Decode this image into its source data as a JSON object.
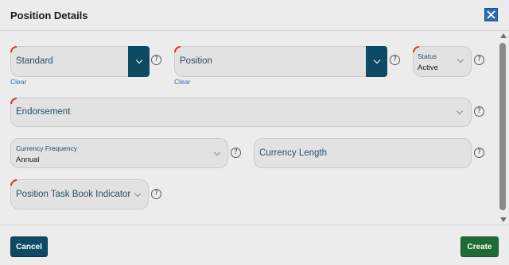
{
  "dialog": {
    "title": "Position Details",
    "close_icon": "close-icon"
  },
  "fields": {
    "standard": {
      "placeholder": "Standard",
      "clear_label": "Clear",
      "required": true
    },
    "position": {
      "placeholder": "Position",
      "clear_label": "Clear",
      "required": true
    },
    "status": {
      "label": "Status",
      "value": "Active",
      "required": true
    },
    "endorsement": {
      "placeholder": "Endorsement",
      "required": true
    },
    "currency_frequency": {
      "label": "Currency Frequency",
      "value": "Annual",
      "required": false
    },
    "currency_length": {
      "placeholder": "Currency Length",
      "required": false
    },
    "task_book_indicator": {
      "placeholder": "Position Task Book Indicator",
      "required": true
    }
  },
  "help_glyph": "?",
  "footer": {
    "cancel_label": "Cancel",
    "create_label": "Create"
  },
  "colors": {
    "primary": "#0e4a63",
    "create": "#1e6b33",
    "close": "#2a6bb4",
    "required": "#d9342b"
  }
}
